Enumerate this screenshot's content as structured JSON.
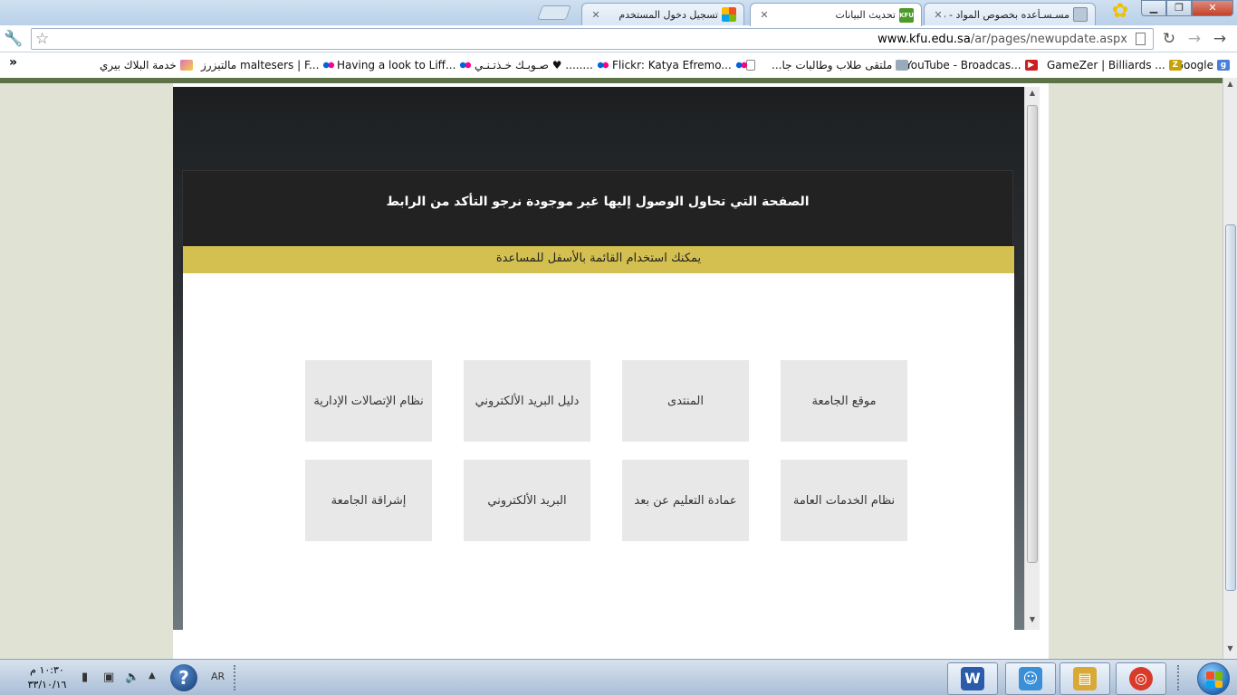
{
  "browser": {
    "tabs": [
      {
        "title": "مسـسـأعده بخصوص المواد - مـ",
        "favicon": "page-icon",
        "active": false
      },
      {
        "title": "تحديث البيانات",
        "favicon": "kfu-icon",
        "favicon_text": "KFU",
        "active": true
      },
      {
        "title": "تسجيل دخول المستخدم",
        "favicon": "windows-icon",
        "active": false
      }
    ],
    "window_buttons": {
      "minimize": "▁",
      "restore": "❐",
      "close": "✕"
    },
    "url_host": "www.kfu.edu.sa",
    "url_path": "/ar/pages/newupdate.aspx",
    "bookmarks": [
      {
        "label": "Google",
        "icon": "google-icon",
        "icon_text": "g",
        "color": "#4a7fd8"
      },
      {
        "label": "GameZer | Billiards ...",
        "icon": "gamezer-icon",
        "icon_text": "Z",
        "color": "#c7a200"
      },
      {
        "label": "YouTube - Broadcas...",
        "icon": "youtube-icon",
        "icon_text": "▶",
        "color": "#cc1f1f"
      },
      {
        "label": "ملتقى طلاب وطالبات جا...",
        "icon": "page-icon",
        "icon_text": "",
        "color": "#9ab"
      },
      {
        "label": "",
        "icon": "blank-page-icon",
        "icon_text": "",
        "color": "#fff"
      },
      {
        "label": "Flickr: Katya Efremo...",
        "icon": "flickr-icon",
        "icon_text": "",
        "color": "#fff"
      },
      {
        "label": "صـوبـك خـذتـنـي ♥ ........",
        "icon": "flickr-icon",
        "icon_text": "",
        "color": "#fff"
      },
      {
        "label": "Having a look to Liff...",
        "icon": "flickr-icon",
        "icon_text": "",
        "color": "#fff"
      },
      {
        "label": "مالتيزرز maltesers | F...",
        "icon": "flickr-icon",
        "icon_text": "",
        "color": "#fff"
      },
      {
        "label": "خدمة البلاك بيري",
        "icon": "pen-icon",
        "icon_text": "",
        "color": "#e070c0"
      }
    ],
    "bookmarks_more": "»"
  },
  "page": {
    "not_found_message": "الصفحة التي تحاول الوصول إليها غير موجودة نرجو التأكد من الرابط",
    "help_hint": "يمكنك استخدام القائمة بالأسفل للمساعدة",
    "tiles": [
      {
        "label": "موقع الجامعة"
      },
      {
        "label": "المنتدى"
      },
      {
        "label": "دليل البريد الألكتروني"
      },
      {
        "label": "نظام الإتصالات الإدارية"
      },
      {
        "label": "نظام الخدمات العامة"
      },
      {
        "label": "عمادة التعليم عن بعد"
      },
      {
        "label": "البريد الألكتروني"
      },
      {
        "label": "إشراقة الجامعة"
      }
    ]
  },
  "taskbar": {
    "clock_time": "١٠:٣٠ م",
    "clock_date": "٣٣/١٠/١٦",
    "language": "AR",
    "help": "?",
    "apps": [
      {
        "name": "word-icon",
        "glyph": "W",
        "color": "#2a5caa"
      },
      {
        "name": "messenger-icon",
        "glyph": "☺",
        "color": "#3b8fd6"
      },
      {
        "name": "explorer-icon",
        "glyph": "▤",
        "color": "#d9a935"
      },
      {
        "name": "chrome-icon",
        "glyph": "◎",
        "color": "#d93b2b"
      }
    ]
  }
}
